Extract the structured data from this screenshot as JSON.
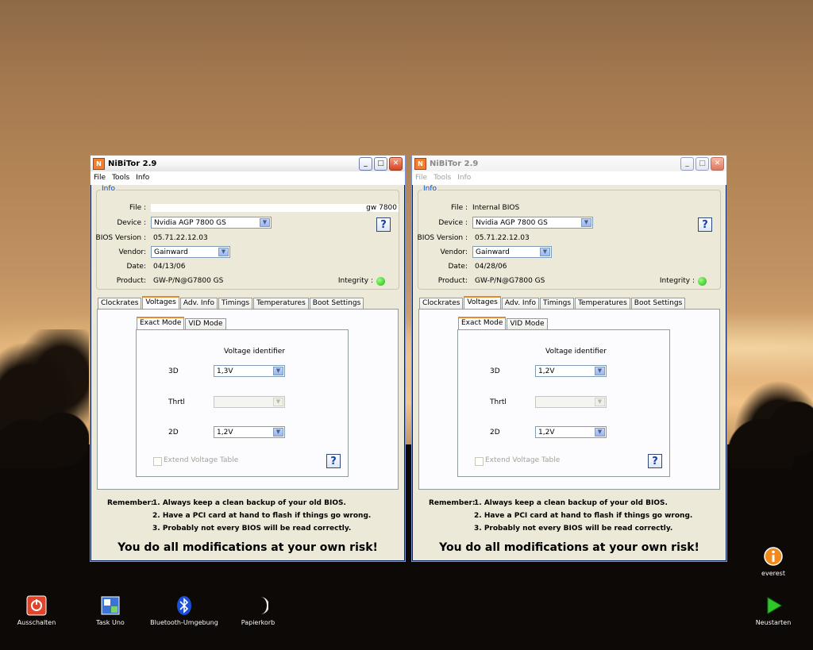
{
  "desktop": {
    "icons": [
      {
        "label": "Ausschalten",
        "icon": "power-icon"
      },
      {
        "label": "Task Uno",
        "icon": "task-icon"
      },
      {
        "label": "Bluetooth-Umgebung",
        "icon": "bluetooth-icon"
      },
      {
        "label": "Papierkorb",
        "icon": "recycle-bin-icon"
      },
      {
        "label": "everest",
        "icon": "info-icon"
      },
      {
        "label": "Neustarten",
        "icon": "restart-icon"
      }
    ]
  },
  "windows": [
    {
      "title": "NiBiTor 2.9",
      "state": "active",
      "menu": [
        "File",
        "Tools",
        "Info"
      ],
      "info": {
        "group_title": "Info",
        "file_label": "File :",
        "file_value": "gw 7800",
        "device_label": "Device :",
        "device_value": "Nvidia AGP 7800 GS",
        "bios_label": "BIOS Version :",
        "bios_value": "05.71.22.12.03",
        "vendor_label": "Vendor:",
        "vendor_value": "Gainward",
        "date_label": "Date:",
        "date_value": "04/13/06",
        "product_label": "Product:",
        "product_value": "GW-P/N@G7800 GS",
        "integrity_label": "Integrity :"
      },
      "tabs": [
        "Clockrates",
        "Voltages",
        "Adv. Info",
        "Timings",
        "Temperatures",
        "Boot Settings"
      ],
      "subtabs": [
        "Exact Mode",
        "VID Mode"
      ],
      "voltage_title": "Voltage identifier",
      "v3d_label": "3D",
      "v3d_value": "1,3V",
      "thrtl_label": "Thrtl",
      "thrtl_value": "",
      "v2d_label": "2D",
      "v2d_value": "1,2V",
      "extend_label": "Extend Voltage Table",
      "remember_label": "Remember:",
      "tips": [
        "1. Always keep a clean backup of your old BIOS.",
        "2. Have a PCI card at hand to flash if things go wrong.",
        "3. Probably not every BIOS will be read correctly."
      ],
      "risk": "You do all modifications at your own risk!"
    },
    {
      "title": "NiBiTor 2.9",
      "state": "inactive",
      "menu": [
        "File",
        "Tools",
        "Info"
      ],
      "info": {
        "group_title": "Info",
        "file_label": "File :",
        "file_value": "Internal BIOS",
        "device_label": "Device :",
        "device_value": "Nvidia AGP 7800 GS",
        "bios_label": "BIOS Version :",
        "bios_value": "05.71.22.12.03",
        "vendor_label": "Vendor:",
        "vendor_value": "Gainward",
        "date_label": "Date:",
        "date_value": "04/28/06",
        "product_label": "Product:",
        "product_value": "GW-P/N@G7800 GS",
        "integrity_label": "Integrity :"
      },
      "tabs": [
        "Clockrates",
        "Voltages",
        "Adv. Info",
        "Timings",
        "Temperatures",
        "Boot Settings"
      ],
      "subtabs": [
        "Exact Mode",
        "VID Mode"
      ],
      "voltage_title": "Voltage identifier",
      "v3d_label": "3D",
      "v3d_value": "1,2V",
      "thrtl_label": "Thrtl",
      "thrtl_value": "",
      "v2d_label": "2D",
      "v2d_value": "1,2V",
      "extend_label": "Extend Voltage Table",
      "remember_label": "Remember:",
      "tips": [
        "1. Always keep a clean backup of your old BIOS.",
        "2. Have a PCI card at hand to flash if things go wrong.",
        "3. Probably not every BIOS will be read correctly."
      ],
      "risk": "You do all modifications at your own risk!"
    }
  ]
}
